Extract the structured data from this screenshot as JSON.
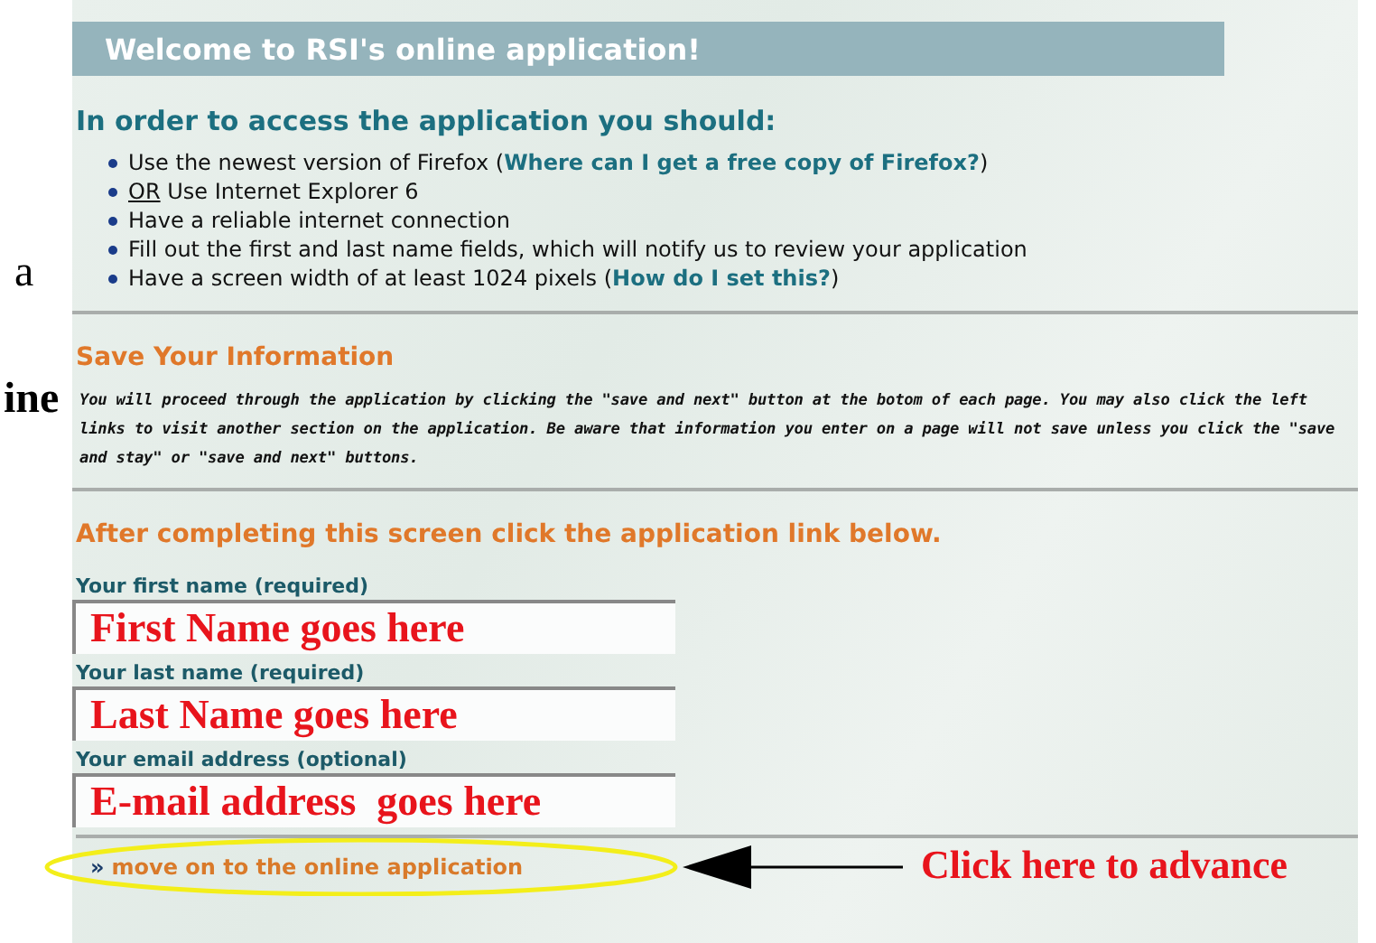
{
  "margin_fragments": [
    {
      "text": "a"
    },
    {
      "text": "ine"
    }
  ],
  "header": {
    "title": "Welcome to RSI's online application!"
  },
  "requirements": {
    "heading": "In order to access the application you should:",
    "items": [
      {
        "text": "Use the newest version of Firefox (",
        "link": "Where can I get a free copy of Firefox?",
        "after": ")"
      },
      {
        "underlined": "OR",
        "text": " Use Internet Explorer 6"
      },
      {
        "text": "Have a reliable internet connection"
      },
      {
        "text": "Fill out the first and last name fields, which will notify us to review your application"
      },
      {
        "text": "Have a screen width of at least 1024 pixels (",
        "link": "How do I set this?",
        "after": ")"
      }
    ]
  },
  "save_info": {
    "heading": "Save Your Information",
    "paragraph": "You will proceed through the application by clicking the \"save and next\" button at the botom of each page. You may also click the left links to visit another section on the application. Be aware that information you enter on a page will not save unless you click the \"save and stay\" or \"save and next\" buttons."
  },
  "form": {
    "heading": "After completing this screen click the application link below.",
    "fields": [
      {
        "label": "Your first name (required)",
        "annotation": "First Name goes here"
      },
      {
        "label": "Your last name (required)",
        "annotation": "Last Name goes here"
      },
      {
        "label": "Your email address (optional)",
        "annotation": "E-mail address  goes here"
      }
    ]
  },
  "next_link": {
    "marker": "»",
    "text": "move on to the online application",
    "annotation": "Click here to advance"
  }
}
